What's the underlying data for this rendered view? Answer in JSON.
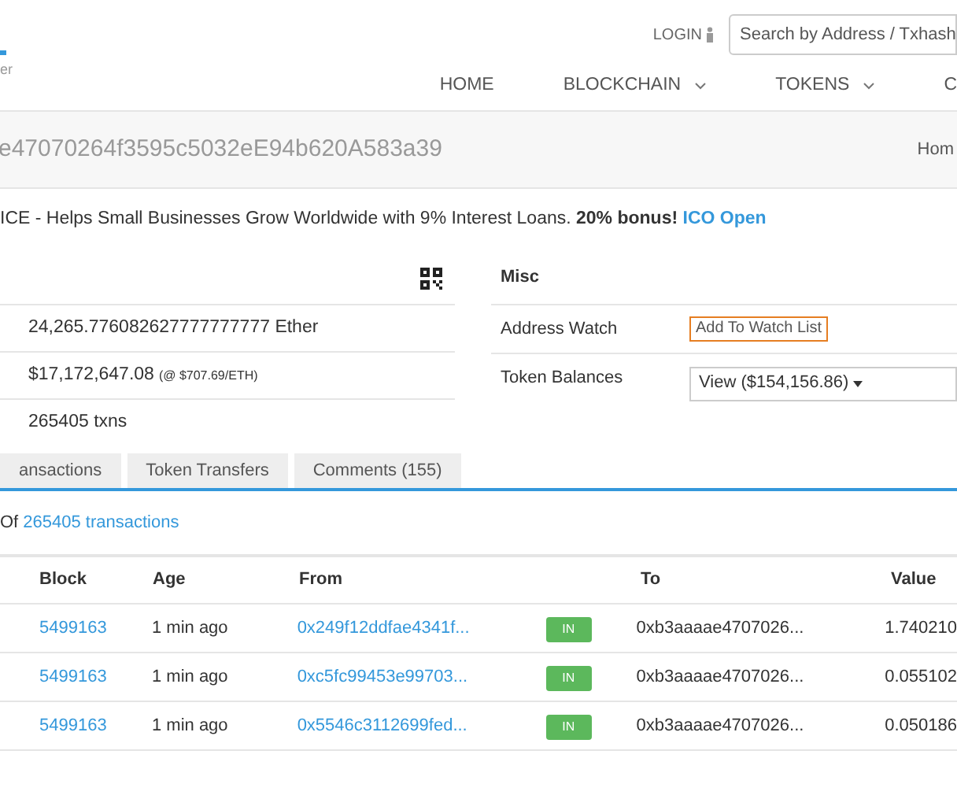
{
  "header": {
    "logo_text": "er",
    "login": "LOGIN",
    "search": {
      "placeholder": "Search by Address / Txhash"
    },
    "nav": [
      {
        "label": "HOME",
        "dropdown": false
      },
      {
        "label": "BLOCKCHAIN",
        "dropdown": true
      },
      {
        "label": "TOKENS",
        "dropdown": true
      },
      {
        "label": "C",
        "dropdown": false
      }
    ]
  },
  "title": {
    "address": "e47070264f3595c5032eE94b620A583a39",
    "breadcrumb": "Hom"
  },
  "ad": {
    "text": "ICE - Helps Small Businesses Grow Worldwide with 9% Interest Loans. **20% bonus!**",
    "link": "ICO Open"
  },
  "overview": {
    "rows": [
      {
        "value": "24,265.776082627777777777 Ether"
      },
      {
        "value": "$17,172,647.08",
        "note": "(@ $707.69/ETH)"
      },
      {
        "value": "265405 txns"
      }
    ]
  },
  "misc": {
    "title": "Misc",
    "rows": [
      {
        "kind": "button",
        "label": "Address Watch",
        "value": "Add To Watch List"
      },
      {
        "kind": "dropdown",
        "label": "Token Balances",
        "value": "View ($154,156.86)"
      }
    ]
  },
  "tabs": [
    {
      "label": "ansactions",
      "selected": false
    },
    {
      "label": "Token Transfers",
      "selected": false
    },
    {
      "label": "Comments (155)",
      "selected": false
    }
  ],
  "summary": {
    "prefix": "Of",
    "link": "265405 transactions"
  },
  "table": {
    "columns": [
      "Block",
      "Age",
      "From",
      "",
      "To",
      "Value"
    ],
    "rows": [
      {
        "block": "5499163",
        "age": "1 min ago",
        "from": "0x249f12ddfae4341f...",
        "direction": "IN",
        "to": "0xb3aaaae4707026...",
        "value": "1.740210"
      },
      {
        "block": "5499163",
        "age": "1 min ago",
        "from": "0xc5fc99453e99703...",
        "direction": "IN",
        "to": "0xb3aaaae4707026...",
        "value": "0.055102"
      },
      {
        "block": "5499163",
        "age": "1 min ago",
        "from": "0x5546c3112699fed...",
        "direction": "IN",
        "to": "0xb3aaaae4707026...",
        "value": "0.050186"
      }
    ]
  }
}
